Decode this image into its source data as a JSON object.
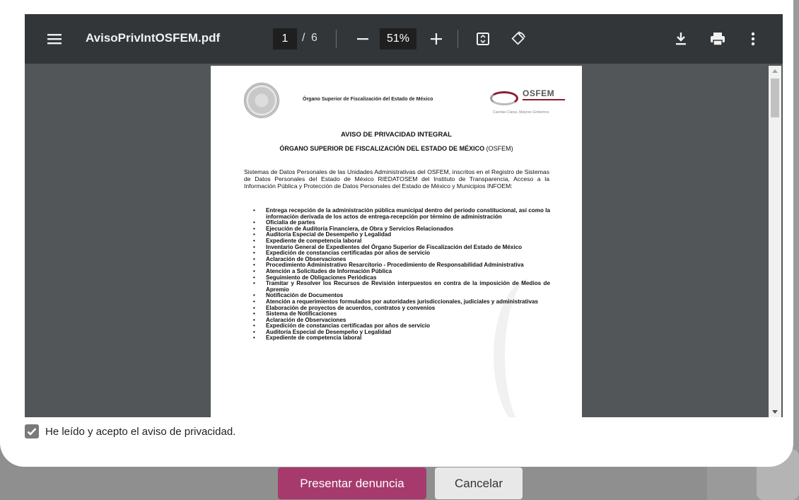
{
  "viewer": {
    "file_name": "AvisoPrivIntOSFEM.pdf",
    "current_page": "1",
    "page_separator": "/",
    "total_pages": "6",
    "zoom": "51%",
    "toolbar_bg": "#323639",
    "canvas_bg": "#525659"
  },
  "document": {
    "org_header": "Órgano Superior de Fiscalización del Estado de México",
    "logo_name": "OSFEM",
    "logo_tagline": "Cuentas Claras, Mejores Gobiernos",
    "title": "AVISO DE PRIVACIDAD INTEGRAL",
    "subtitle_bold": "ÓRGANO SUPERIOR DE FISCALIZACIÓN DEL ESTADO DE MÉXICO",
    "subtitle_rest": " (OSFEM)",
    "intro": "Sistemas de Datos Personales de las Unidades Administrativas del OSFEM, inscritos en el Registro de Sistemas de Datos Personales del Estado de México RIEDATOSEM del Instituto de Transparencia, Acceso a la Información Pública y Protección de Datos Personales del Estado de México y Municipios INFOEM:",
    "bullets": [
      "Entrega recepción de la administración pública municipal dentro del periodo constitucional, así como la información derivada de los actos de entrega-recepción por término de administración",
      "Oficialía de partes",
      "Ejecución de Auditoría Financiera, de Obra y Servicios Relacionados",
      "Auditoría Especial de Desempeño y Legalidad",
      "Expediente de competencia laboral",
      "Inventario General de Expedientes del Órgano Superior de Fiscalización del Estado de México",
      "Expedición de constancias certificadas por años de servicio",
      "Aclaración de Observaciones",
      "Procedimiento Administrativo Resarcitorio - Procedimiento de Responsabilidad Administrativa",
      "Atención a Solicitudes de Información Pública",
      "Seguimiento de Obligaciones Periódicas",
      "Tramitar y Resolver los Recursos de Revisión interpuestos en contra de la imposición de Medios de Apremio",
      "Notificación de Documentos",
      "Atención a requerimientos formulados por autoridades jurisdiccionales, judiciales y administrativas",
      "Elaboración de proyectos de acuerdos, contratos y convenios",
      "Sistema de Notificaciones",
      "Aclaración de Observaciones",
      "Expedición de constancias certificadas por años de servicio",
      "Auditoría Especial de Desempeño y Legalidad",
      "Expediente de competencia laboral"
    ]
  },
  "consent": {
    "checked": true,
    "label": "He leído y acepto el aviso de privacidad."
  },
  "actions": {
    "primary_label": "Presentar denuncia",
    "secondary_label": "Cancelar",
    "primary_color": "#a63a6c"
  },
  "icons": {
    "menu": "menu-icon",
    "zoom_out": "minus-icon",
    "zoom_in": "plus-icon",
    "fit": "fit-page-icon",
    "rotate": "rotate-icon",
    "download": "download-icon",
    "print": "print-icon",
    "more": "more-vertical-icon"
  }
}
